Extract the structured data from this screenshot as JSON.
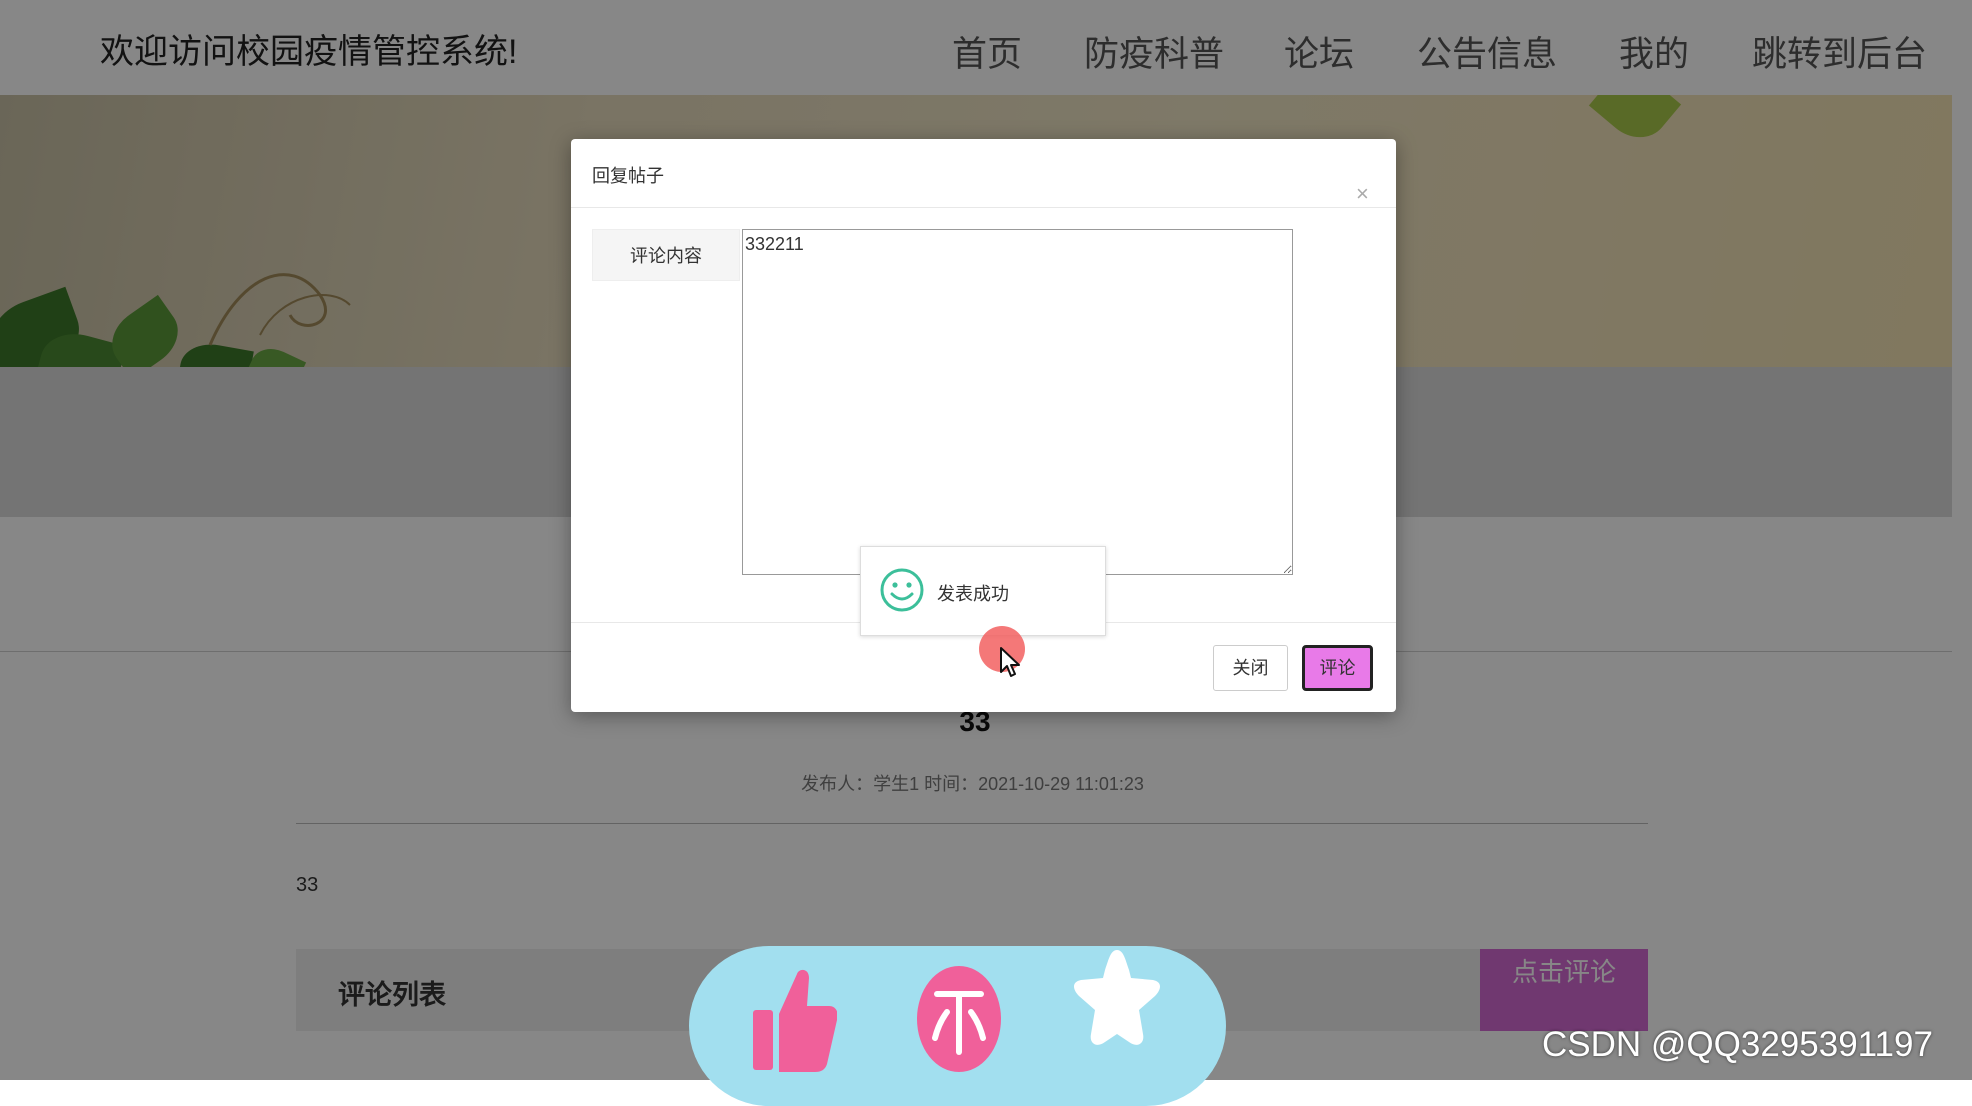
{
  "header": {
    "site_title": "欢迎访问校园疫情管控系统!",
    "nav": [
      "首页",
      "防疫科普",
      "论坛",
      "公告信息",
      "我的",
      "跳转到后台"
    ]
  },
  "post": {
    "title": "33",
    "meta": "发布人：学生1 时间：2021-10-29 11:01:23",
    "content": "33"
  },
  "comments": {
    "list_title": "评论列表",
    "button_label": "点击评论"
  },
  "dialog": {
    "title": "回复帖子",
    "close_glyph": "×",
    "field_label": "评论内容",
    "field_value": "332211",
    "close_button": "关闭",
    "submit_button": "评论"
  },
  "toast": {
    "message": "发表成功",
    "icon": "smile-icon"
  },
  "dock": {
    "icons": [
      "thumbs-up-icon",
      "coin-icon",
      "star-icon"
    ]
  },
  "watermark": "CSDN @QQ3295391197",
  "colors": {
    "accent_pink": "#e87ae8",
    "dock_bg": "#a2dfef",
    "dock_icon": "#f0609a",
    "toast_icon": "#3cbf9a"
  }
}
